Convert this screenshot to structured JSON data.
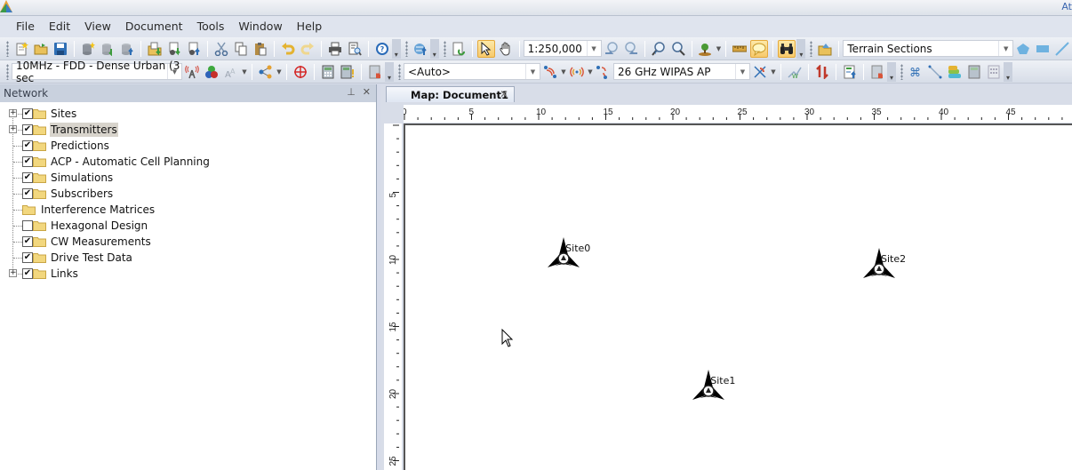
{
  "window": {
    "title": "At"
  },
  "menu": [
    "File",
    "Edit",
    "View",
    "Document",
    "Tools",
    "Window",
    "Help"
  ],
  "toolbar1": {
    "icons_left": [
      "new-document-icon",
      "open-folder-icon",
      "save-icon",
      "new-database-icon",
      "refresh-database-icon",
      "archive-database-icon",
      "import-icon",
      "import-config-icon",
      "export-config-icon",
      "cut-icon",
      "copy-icon",
      "paste-icon",
      "undo-icon",
      "redo-icon",
      "print-icon",
      "print-preview-icon",
      "help-icon"
    ],
    "scale_value": "1:250,000",
    "terrain_select": "Terrain Sections"
  },
  "toolbar2": {
    "profile_select": "10MHz - FDD - Dense Urban (3 sec",
    "auto_select": "<Auto>",
    "equipment_select": "26 GHz WIPAS AP"
  },
  "network_panel": {
    "title": "Network",
    "items": [
      {
        "label": "Sites",
        "checked": true,
        "expandable": true,
        "selected": false
      },
      {
        "label": "Transmitters",
        "checked": true,
        "expandable": true,
        "selected": true
      },
      {
        "label": "Predictions",
        "checked": true,
        "expandable": false,
        "selected": false
      },
      {
        "label": "ACP - Automatic Cell Planning",
        "checked": true,
        "expandable": false,
        "selected": false
      },
      {
        "label": "Simulations",
        "checked": true,
        "expandable": false,
        "selected": false
      },
      {
        "label": "Subscribers",
        "checked": true,
        "expandable": false,
        "selected": false
      },
      {
        "label": "Interference Matrices",
        "checked": null,
        "expandable": false,
        "selected": false
      },
      {
        "label": "Hexagonal Design",
        "checked": false,
        "expandable": false,
        "selected": false
      },
      {
        "label": "CW Measurements",
        "checked": true,
        "expandable": false,
        "selected": false
      },
      {
        "label": "Drive Test Data",
        "checked": true,
        "expandable": false,
        "selected": false
      },
      {
        "label": "Links",
        "checked": true,
        "expandable": true,
        "selected": false
      }
    ]
  },
  "map": {
    "tab_label": "Map: Document1",
    "h_ruler": [
      "0",
      "5",
      "10",
      "15",
      "20",
      "25",
      "30",
      "35",
      "40",
      "45"
    ],
    "v_ruler": [
      "5",
      "10",
      "15",
      "20",
      "25"
    ],
    "sites": [
      {
        "name": "Site0",
        "x_km": 11.8,
        "y_km": 9.8
      },
      {
        "name": "Site2",
        "x_km": 35.3,
        "y_km": 10.6
      },
      {
        "name": "Site1",
        "x_km": 22.6,
        "y_km": 19.7
      }
    ]
  }
}
